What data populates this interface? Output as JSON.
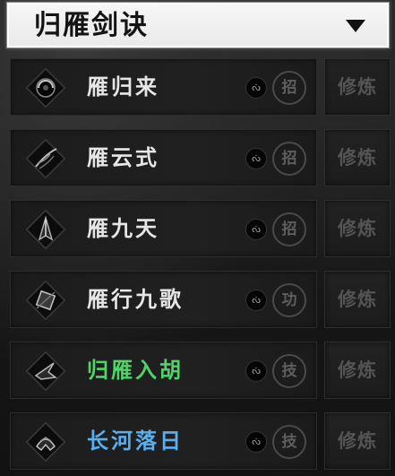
{
  "header": {
    "title": "归雁剑诀",
    "dropdown_icon": "triangle-down-icon"
  },
  "skills": [
    {
      "name": "雁归来",
      "rank_symbol": "ᔔ",
      "type": "招",
      "name_color": "#e6e6e6",
      "action_label": "修炼",
      "icon": "swirl-orb-icon"
    },
    {
      "name": "雁云式",
      "rank_symbol": "ᔔ",
      "type": "招",
      "name_color": "#e6e6e6",
      "action_label": "修炼",
      "icon": "feather-flourish-icon"
    },
    {
      "name": "雁九天",
      "rank_symbol": "ᔔ",
      "type": "招",
      "name_color": "#e6e6e6",
      "action_label": "修炼",
      "icon": "wing-cloak-icon"
    },
    {
      "name": "雁行九歌",
      "rank_symbol": "ᔔ",
      "type": "功",
      "name_color": "#e6e6e6",
      "action_label": "修炼",
      "icon": "cube-seal-icon"
    },
    {
      "name": "归雁入胡",
      "rank_symbol": "ᔔ",
      "type": "技",
      "name_color": "#4fd46a",
      "action_label": "修炼",
      "icon": "flying-blade-icon"
    },
    {
      "name": "长河落日",
      "rank_symbol": "ᔔ",
      "type": "技",
      "name_color": "#58b0f0",
      "action_label": "修炼",
      "icon": "crest-helm-icon"
    }
  ]
}
